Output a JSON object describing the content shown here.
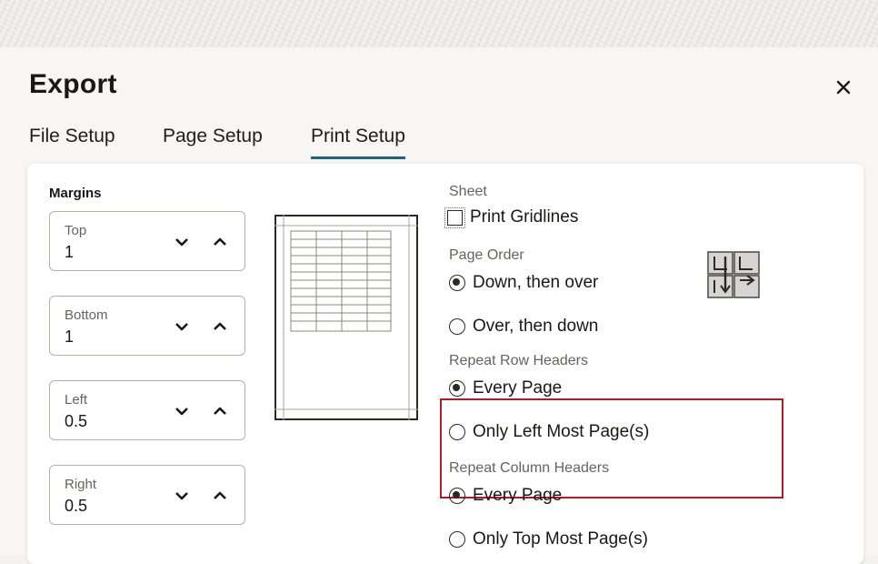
{
  "dialog": {
    "title": "Export"
  },
  "tabs": [
    {
      "label": "File Setup",
      "active": false
    },
    {
      "label": "Page Setup",
      "active": false
    },
    {
      "label": "Print Setup",
      "active": true
    }
  ],
  "margins": {
    "label": "Margins",
    "fields": [
      {
        "label": "Top",
        "value": "1"
      },
      {
        "label": "Bottom",
        "value": "1"
      },
      {
        "label": "Left",
        "value": "0.5"
      },
      {
        "label": "Right",
        "value": "0.5"
      }
    ]
  },
  "sheet": {
    "label": "Sheet",
    "print_gridlines": {
      "label": "Print Gridlines",
      "checked": false
    }
  },
  "page_order": {
    "label": "Page Order",
    "options": [
      {
        "label": "Down, then over",
        "selected": true
      },
      {
        "label": "Over, then down",
        "selected": false
      }
    ]
  },
  "repeat_row_headers": {
    "label": "Repeat Row Headers",
    "options": [
      {
        "label": "Every Page",
        "selected": true
      },
      {
        "label": "Only Left Most Page(s)",
        "selected": false
      }
    ]
  },
  "repeat_column_headers": {
    "label": "Repeat Column Headers",
    "options": [
      {
        "label": "Every Page",
        "selected": true
      },
      {
        "label": "Only Top Most Page(s)",
        "selected": false
      }
    ]
  },
  "colors": {
    "tab_underline": "#2a5d7c",
    "highlight_border": "#b01c22"
  }
}
